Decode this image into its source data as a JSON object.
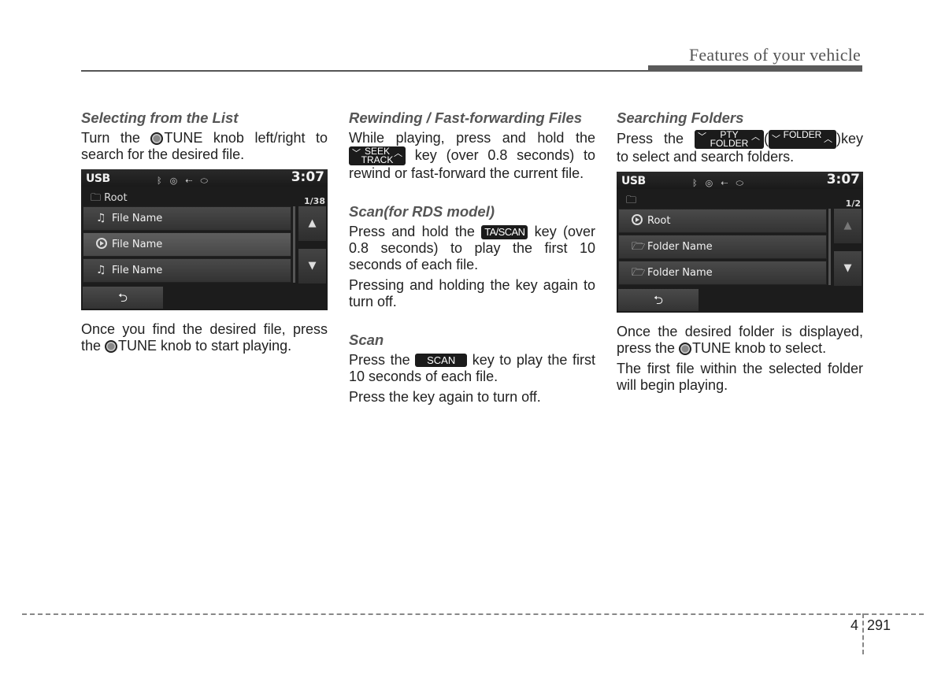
{
  "header": {
    "title": "Features of your vehicle"
  },
  "col1": {
    "heading": "Selecting from the List",
    "p1_pre": "Turn the ",
    "p1_post": "TUNE knob left/right to search for the desired file.",
    "screen": {
      "source": "USB",
      "time": "3:07",
      "status_icons": [
        "bluetooth-icon",
        "disc-icon",
        "usb-icon",
        "battery-icon"
      ],
      "path": "Root",
      "count": "1/38",
      "rows": [
        {
          "icon": "music-note-icon",
          "label": "File Name",
          "selected": false
        },
        {
          "icon": "play-icon",
          "label": "File Name",
          "selected": true
        },
        {
          "icon": "music-note-icon",
          "label": "File Name",
          "selected": false
        }
      ],
      "up_glyph": "▲",
      "down_glyph": "▼",
      "back_glyph": "⮌"
    },
    "p2_pre": "Once you find the desired file, press the ",
    "p2_post": "TUNE knob to start playing."
  },
  "col2": {
    "rewind": {
      "heading": "Rewinding / Fast-forwarding Files",
      "p_pre": "While playing, press and hold the ",
      "key_top": "SEEK",
      "key_bottom": "TRACK",
      "p_post": " key (over 0.8 seconds) to rewind or fast-forward the current file."
    },
    "scan_rds": {
      "heading": "Scan(for RDS model)",
      "p1_pre": "Press and hold the ",
      "key": "TA/SCAN",
      "p1_post": " key (over 0.8 seconds) to play the first 10 seconds of each file.",
      "p2": "Pressing and holding the key again to turn off."
    },
    "scan": {
      "heading": "Scan",
      "p1_pre": "Press the ",
      "key": "SCAN",
      "p1_post": " key to play the first 10 seconds of each file.",
      "p2": "Press the key again to turn off."
    }
  },
  "col3": {
    "heading": "Searching Folders",
    "p1_pre": "Press the ",
    "key1_top": "PTY",
    "key1_bottom": "FOLDER",
    "p1_mid": "(",
    "key2": "FOLDER",
    "p1_post": ")key to select and search folders.",
    "screen": {
      "source": "USB",
      "time": "3:07",
      "status_icons": [
        "bluetooth-icon",
        "disc-icon",
        "usb-icon",
        "battery-icon"
      ],
      "path": "",
      "count": "1/2",
      "rows": [
        {
          "icon": "play-icon",
          "label": "Root",
          "selected": false
        },
        {
          "icon": "folder-icon",
          "label": "Folder Name",
          "selected": false
        },
        {
          "icon": "folder-icon",
          "label": "Folder Name",
          "selected": false
        }
      ],
      "up_glyph": "▲",
      "down_glyph": "▼",
      "back_glyph": "⮌"
    },
    "p2_pre": "Once the desired folder is displayed, press the ",
    "p2_post": "TUNE knob to select.",
    "p3": "The first file within the selected folder will begin playing."
  },
  "footer": {
    "chapter": "4",
    "page": "291"
  }
}
